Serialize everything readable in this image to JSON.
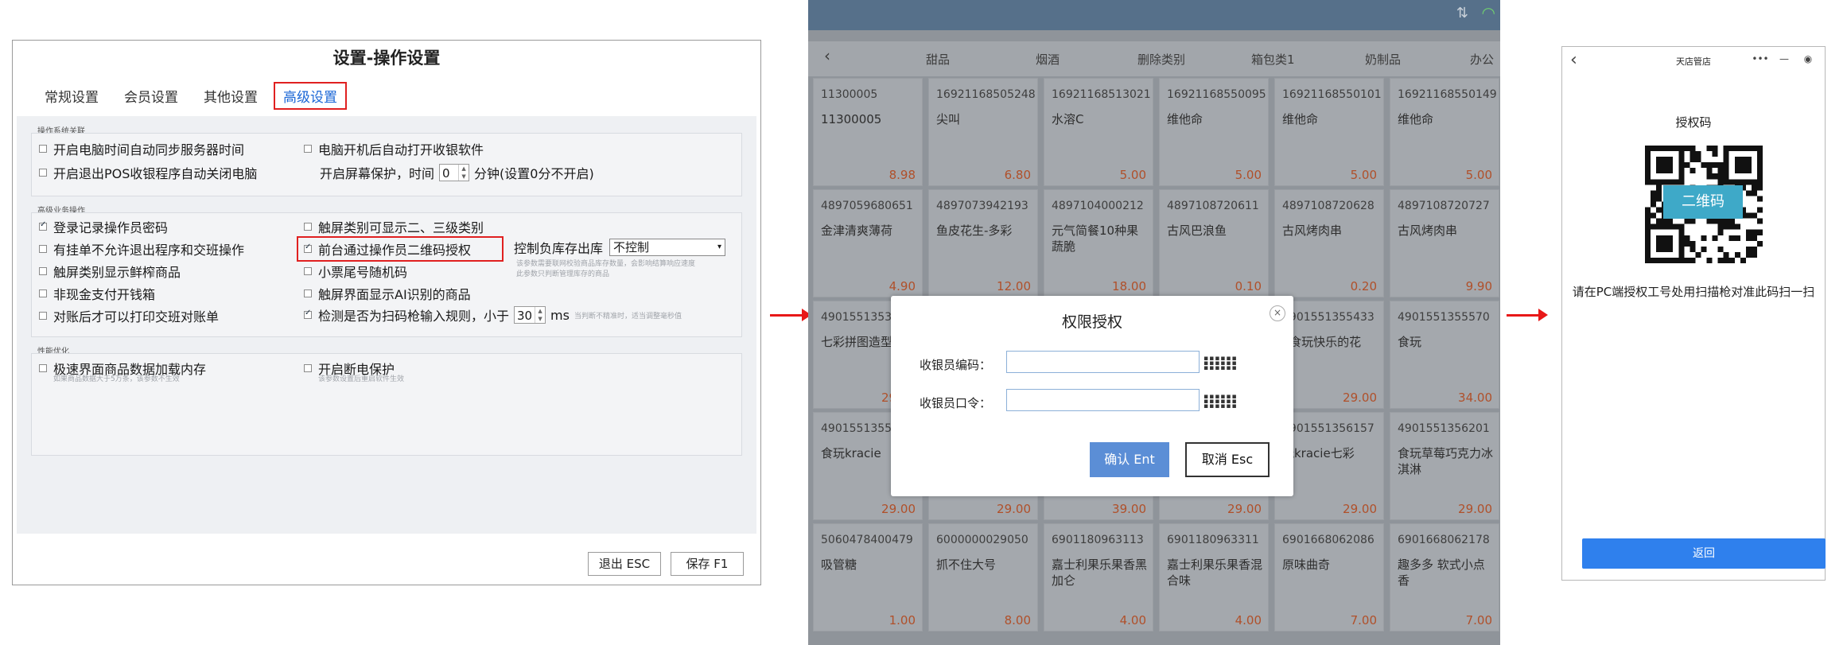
{
  "settings": {
    "title": "设置-操作设置",
    "tabs": [
      "常规设置",
      "会员设置",
      "其他设置",
      "高级设置"
    ],
    "active_tab": 3,
    "groups": {
      "system": "操作系统关联",
      "business": "高级业务操作",
      "performance": "性能优化"
    },
    "options": {
      "sync_time": "开启电脑时间自动同步服务器时间",
      "auto_start": "电脑开机后自动打开收银软件",
      "shutdown_on_exit": "开启退出POS收银程序自动关闭电脑",
      "screensaver_label": "开启屏幕保护，时间",
      "screensaver_value": "0",
      "screensaver_unit": "分钟(设置0分不开启)",
      "login_password": "登录记录操作员密码",
      "touch_category": "触屏类别可显示二、三级类别",
      "pending_orders": "有挂单不允许退出程序和交班操作",
      "qr_auth": "前台通过操作员二维码授权",
      "negative_stock_label": "控制负库存出库",
      "negative_stock_value": "不控制",
      "negative_stock_hint_1": "该参数需要联网校验商品库存数量，会影响结算响应速度",
      "negative_stock_hint_2": "此参数只判断管理库存的商品",
      "touch_fresh": "触屏类别显示鲜榨商品",
      "receipt_random": "小票尾号随机码",
      "cash_drawer": "非现金支付开钱箱",
      "ai_products": "触屏界面显示AI识别的商品",
      "print_reconcile": "对账后才可以打印交班对账单",
      "scanner_rule": "检测是否为扫码枪输入规则，小于",
      "scanner_value": "30",
      "scanner_unit": "ms",
      "scanner_hint": "当判断不精准时，适当调整毫秒值",
      "fast_load": "极速界面商品数据加载内存",
      "fast_load_hint": "如果商品数据大于5万条，该参数不生效",
      "power_protect": "开启断电保护",
      "power_protect_hint": "该参数设置后重启软件生效"
    },
    "checked": {
      "login_password": true,
      "qr_auth": true,
      "scanner_rule": true
    },
    "buttons": {
      "exit": "退出 ESC",
      "save": "保存 F1"
    }
  },
  "pos": {
    "categories": [
      "甜品",
      "烟酒",
      "删除类别",
      "箱包类1",
      "奶制品",
      "办公"
    ],
    "products": [
      {
        "code": "11300005",
        "name": "11300005",
        "price": "8.98"
      },
      {
        "code": "16921168505248",
        "name": "尖叫",
        "price": "6.80"
      },
      {
        "code": "16921168513021",
        "name": "水溶C",
        "price": "5.00"
      },
      {
        "code": "16921168550095",
        "name": "维他命",
        "price": "5.00"
      },
      {
        "code": "16921168550101",
        "name": "维他命",
        "price": "5.00"
      },
      {
        "code": "16921168550149",
        "name": "维他命",
        "price": "5.00"
      },
      {
        "code": "4897059680651",
        "name": "金津清爽薄荷",
        "price": "4.90"
      },
      {
        "code": "4897073942193",
        "name": "鱼皮花生-多彩",
        "price": "12.00"
      },
      {
        "code": "4897104000212",
        "name": "元气简餐10种果蔬脆",
        "price": "18.00"
      },
      {
        "code": "4897108720611",
        "name": "古风巴浪鱼",
        "price": "0.10"
      },
      {
        "code": "4897108720628",
        "name": "古风烤肉串",
        "price": "0.20"
      },
      {
        "code": "4897108720727",
        "name": "古风烤肉串",
        "price": "9.90"
      },
      {
        "code": "4901551353",
        "name": "七彩拼图造型工糖",
        "price": "29.00"
      },
      {
        "code": "",
        "name": "",
        "price": ""
      },
      {
        "code": "",
        "name": "",
        "price": ""
      },
      {
        "code": "",
        "name": "",
        "price": ""
      },
      {
        "code": "4901551355433",
        "name": "Y食玩快乐的花",
        "price": "29.00"
      },
      {
        "code": "4901551355570",
        "name": "食玩",
        "price": "34.00"
      },
      {
        "code": "4901551355",
        "name": "食玩kracie",
        "price": "29.00"
      },
      {
        "code": "",
        "name": "",
        "price": "29.00"
      },
      {
        "code": "",
        "name": "",
        "price": "39.00"
      },
      {
        "code": "",
        "name": "",
        "price": "29.00"
      },
      {
        "code": "4901551356157",
        "name": "玩kracie七彩",
        "price": "29.00"
      },
      {
        "code": "4901551356201",
        "name": "食玩草莓巧克力冰淇淋",
        "price": "29.00"
      },
      {
        "code": "5060478400479",
        "name": "吸管糖",
        "price": "1.00"
      },
      {
        "code": "6000000029050",
        "name": "抓不住大号",
        "price": "8.00"
      },
      {
        "code": "6901180963113",
        "name": "嘉士利果乐果香黑加仑",
        "price": "4.00"
      },
      {
        "code": "6901180963311",
        "name": "嘉士利果乐果香混合味",
        "price": "4.00"
      },
      {
        "code": "6901668062086",
        "name": "原味曲奇",
        "price": "7.00"
      },
      {
        "code": "6901668062178",
        "name": "趣多多 软式小点 香",
        "price": "7.00"
      }
    ],
    "dialog": {
      "title": "权限授权",
      "close": "×",
      "cashier_code_label": "收银员编码：",
      "cashier_pass_label": "收银员口令：",
      "keyboard_glyph": "▪▪▪▪▪▪",
      "ok": "确认 Ent",
      "cancel": "取消 Esc"
    }
  },
  "mobile": {
    "title": "天店管店",
    "back": "‹",
    "capsule": [
      "•••",
      "—",
      "◉"
    ],
    "label": "授权码",
    "qr_tag": "二维码",
    "instruction": "请在PC端授权工号处用扫描枪对准此码扫一扫",
    "back_button": "返回"
  },
  "colors": {
    "accent_blue": "#1a66d6",
    "highlight_red": "#e02020",
    "dialog_ok": "#5b8ed6",
    "mobile_button": "#2f80ed"
  }
}
